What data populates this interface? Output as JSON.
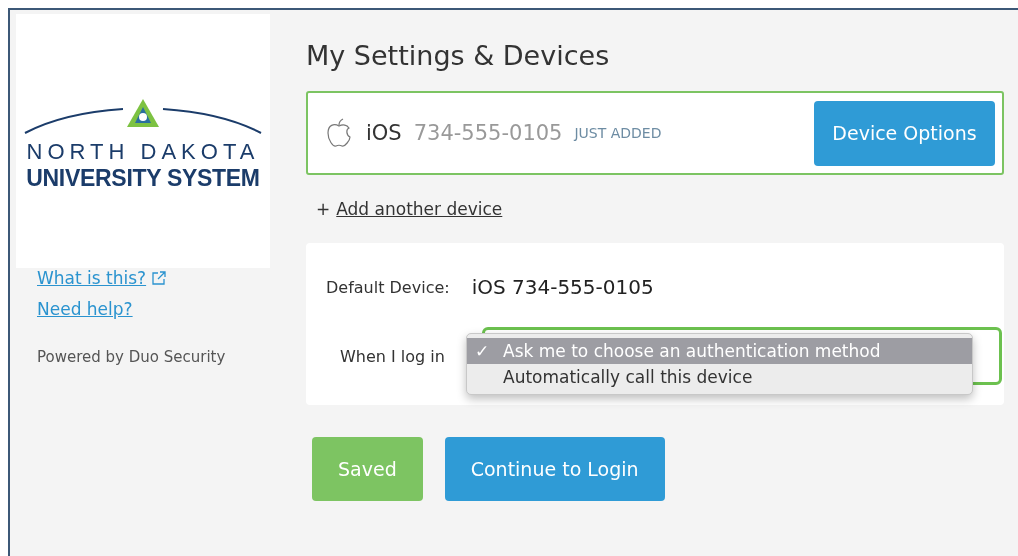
{
  "sidebar": {
    "logo": {
      "line_1": "NORTH DAKOTA",
      "line_2": "UNIVERSITY SYSTEM"
    },
    "links": [
      {
        "label": "What is this?",
        "external": true
      },
      {
        "label": "Need help?",
        "external": false
      }
    ],
    "footer": "Powered by Duo Security"
  },
  "main": {
    "title": "My Settings & Devices",
    "device": {
      "os": "iOS",
      "number": "734-555-0105",
      "badge": "JUST ADDED",
      "button": "Device Options"
    },
    "add_device": {
      "prefix": "+",
      "label": "Add another device"
    },
    "settings": {
      "default_label": "Default Device:",
      "default_value": "iOS 734-555-0105",
      "login_label": "When I log in",
      "menu": [
        {
          "label": "Ask me to choose an authentication method",
          "mark": "✓",
          "selected": true
        },
        {
          "label": "Automatically call this device",
          "selected": false
        }
      ]
    },
    "buttons": [
      {
        "label": "Saved",
        "kind": "success"
      },
      {
        "label": "Continue to Login",
        "kind": "primary"
      }
    ]
  }
}
